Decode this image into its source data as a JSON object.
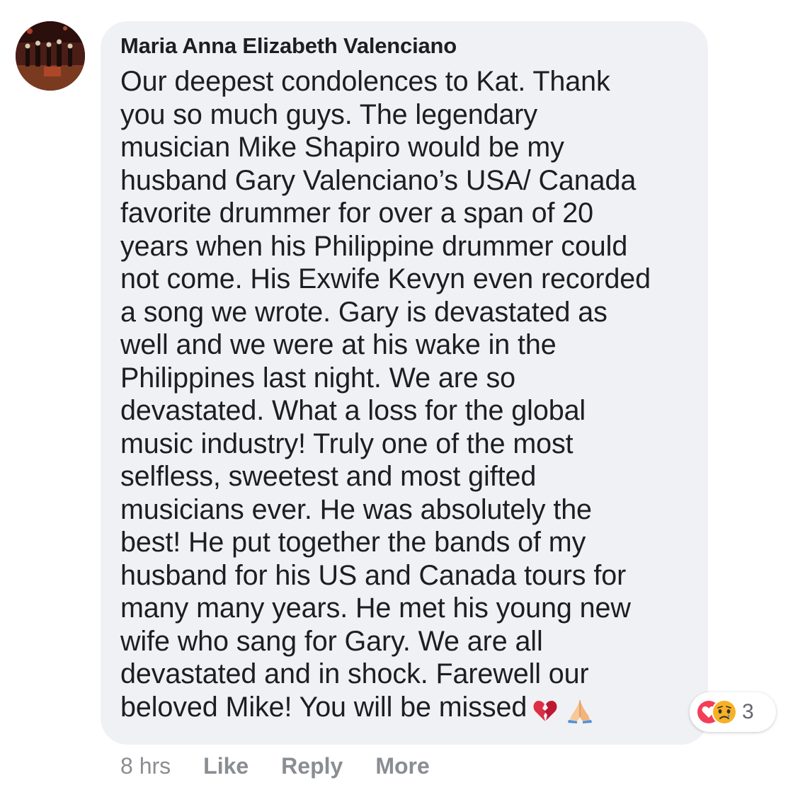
{
  "comment": {
    "author": "Maria Anna Elizabeth Valenciano",
    "lines": [
      "Our deepest condolences to Kat. Thank",
      "you so much guys. The legendary",
      "musician Mike Shapiro would be my",
      "husband Gary Valenciano’s USA/ Canada",
      "favorite drummer for over a span of 20",
      "years when his Philippine drummer could",
      "not come. His Exwife Kevyn even recorded",
      "a song we wrote. Gary is devastated as",
      "well and we were at his wake in the",
      "Philippines last night. We are so",
      "devastated. What a loss for the global",
      "music industry! Truly one of the most",
      "selfless, sweetest and most gifted",
      "musicians ever. He was absolutely the",
      "best! He put together the bands of my",
      "husband for his US and Canada tours for",
      "many many years. He met his young new",
      "wife who sang for Gary. We are all",
      "devastated and in shock. Farewell our",
      "beloved Mike! You will be missed"
    ],
    "trailing_emojis": [
      "broken-heart-icon",
      "folded-hands-icon"
    ],
    "reactions": {
      "types": [
        "love-reaction-icon",
        "sad-reaction-icon"
      ],
      "count": "3"
    },
    "timestamp": "8 hrs",
    "actions": {
      "like": "Like",
      "reply": "Reply",
      "more": "More"
    }
  },
  "colors": {
    "bubble": "#f0f1f4",
    "text": "#1c1e21",
    "meta": "#8a8d91",
    "love": "#f33e58",
    "sad": "#f7b125"
  }
}
